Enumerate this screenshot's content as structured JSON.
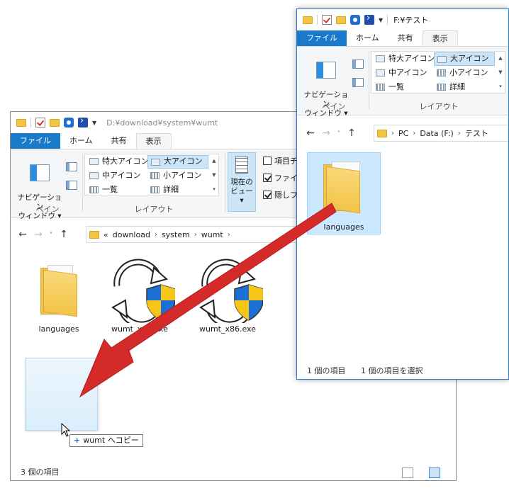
{
  "window_back": {
    "title": "D:¥download¥system¥wumt",
    "tabs": [
      "ファイル",
      "ホーム",
      "共有",
      "表示"
    ],
    "ribbon": {
      "nav_pane_label": "ナビゲーション\nウィンドウ ▾",
      "pane_group": "ペイン",
      "layout_group": "レイアウト",
      "layout_items": [
        "特大アイコン",
        "大アイコン",
        "中アイコン",
        "小アイコン",
        "一覧",
        "詳細"
      ],
      "current_view": "現在の\nビュー ▾",
      "checkbox_items": [
        "項目チ",
        "ファイル",
        "隠しフ"
      ]
    },
    "address": {
      "prefix": "«",
      "crumbs": [
        "download",
        "system",
        "wumt"
      ]
    },
    "items": [
      "languages",
      "wumt_x64.exe",
      "wumt_x86.exe"
    ],
    "status": "3 個の項目"
  },
  "window_front": {
    "title": "F:¥テスト",
    "tabs": [
      "ファイル",
      "ホーム",
      "共有",
      "表示"
    ],
    "ribbon": {
      "nav_pane_label": "ナビゲーション\nウィンドウ ▾",
      "pane_group": "ペイン",
      "layout_group": "レイアウト",
      "layout_items": [
        "特大アイコン",
        "大アイコン",
        "中アイコン",
        "小アイコン",
        "一覧",
        "詳細"
      ]
    },
    "address": {
      "crumbs": [
        "PC",
        "Data (F:)",
        "テスト"
      ]
    },
    "items": [
      "languages"
    ],
    "status_count": "1 個の項目",
    "status_selected": "1 個の項目を選択"
  },
  "drag": {
    "tooltip": "wumt へコピー"
  },
  "colors": {
    "accent": "#1979ca",
    "arrow": "#d42a2a",
    "selection": "#cce4f7"
  }
}
